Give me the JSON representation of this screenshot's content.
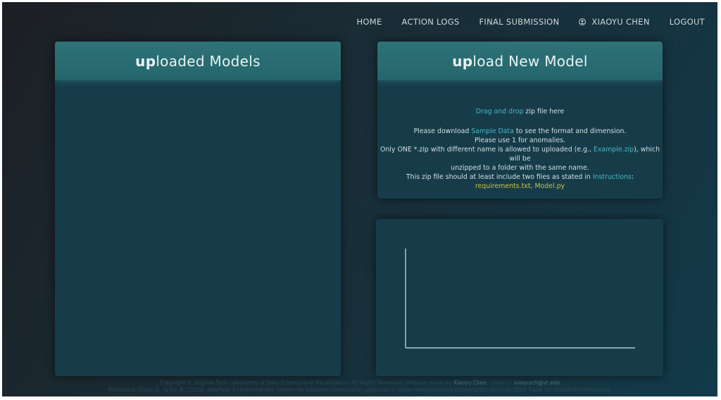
{
  "nav": {
    "home": "HOME",
    "action_logs": "ACTION LOGS",
    "final_submission": "FINAL SUBMISSION",
    "user_name": "XIAOYU CHEN",
    "logout": "LOGOUT",
    "user_icon": "user-circle-icon"
  },
  "left_panel": {
    "title_bold": "up",
    "title_rest": "loaded Models"
  },
  "upload_panel": {
    "title_bold": "up",
    "title_rest": "load New Model",
    "drag_link": "Drag and drop",
    "drag_rest": " zip file here",
    "line1_pre": "Please download ",
    "line1_link": "Sample Data",
    "line1_post": " to see the format and dimension.",
    "line2": "Please use 1 for anomalies.",
    "line3_pre": "Only ONE *.zip with different name is allowed to uploaded (e.g., ",
    "line3_link": "Example.zip",
    "line3_post": "), which will be",
    "line4": "unzipped to a folder with the same name.",
    "line5_pre": "This zip file should at least include two files as stated in ",
    "line5_link": "Instructions",
    "line5_post": ":",
    "files": "requirements.txt, Model.py"
  },
  "chart_data": {
    "type": "line",
    "title": "",
    "xlabel": "",
    "ylabel": "",
    "series": []
  },
  "footer": {
    "line1_pre": "Copyright © Virginia Tech Laboratory of Data Science and Visualization. All Rights Reserved. Website made by ",
    "line1_name": "Xiaoyu Chen",
    "line1_mid": ". Contact: ",
    "line1_email": "xiaoyuch@vt.edu",
    "line2": "Reference: Chen, X., & Jin, R. (2020). AdaPipe: A recommender system for adaptive computation pipelines in cyber-manufacturing computation services. IEEE Trans. on Industrial Informatics."
  },
  "colors": {
    "accent_link": "#46b6c0",
    "highlight": "#c9c342",
    "header_bg": "#2a6e74",
    "panel_bg": "#163c4a"
  }
}
